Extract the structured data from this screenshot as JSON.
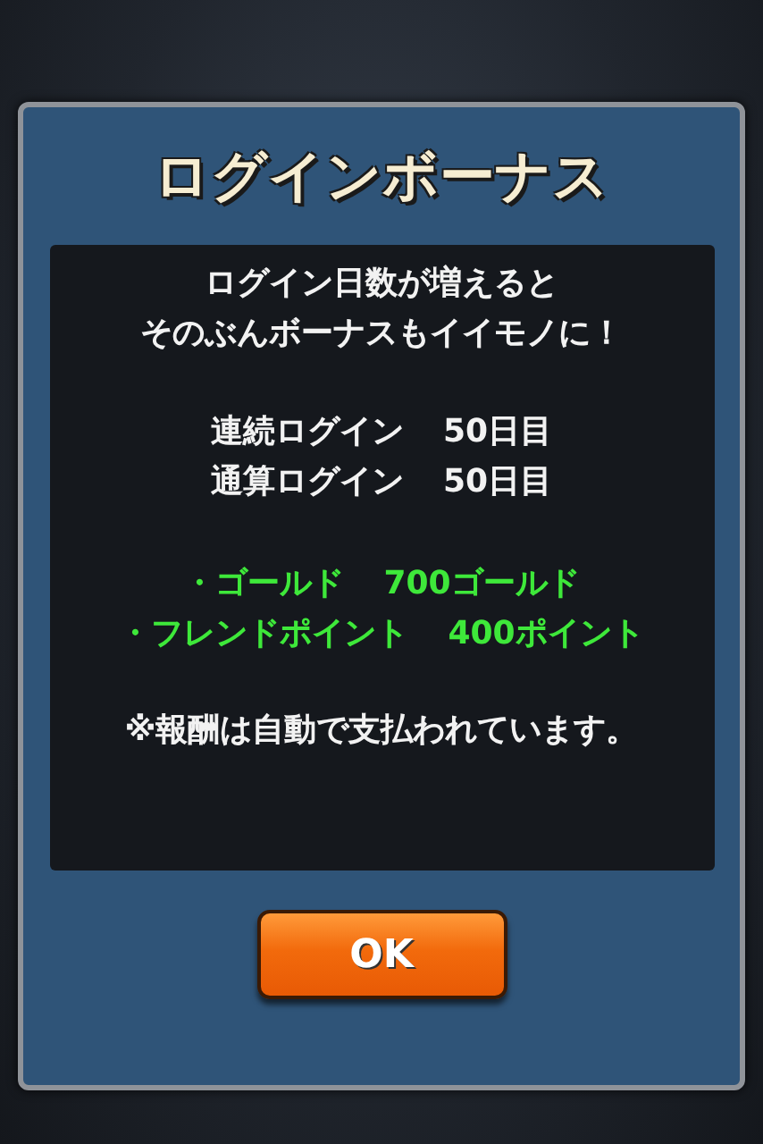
{
  "dialog": {
    "title": "ログインボーナス",
    "message": [
      "ログイン日数が増えると",
      "そのぶんボーナスもイイモノに！"
    ],
    "login_stats": [
      {
        "label": "連続ログイン",
        "value": "50日目"
      },
      {
        "label": "通算ログイン",
        "value": "50日目"
      }
    ],
    "rewards": [
      {
        "label": "・ゴールド",
        "value": "700ゴールド"
      },
      {
        "label": "・フレンドポイント",
        "value": "400ポイント"
      }
    ],
    "note": "※報酬は自動で支払われています。",
    "button": "OK"
  }
}
